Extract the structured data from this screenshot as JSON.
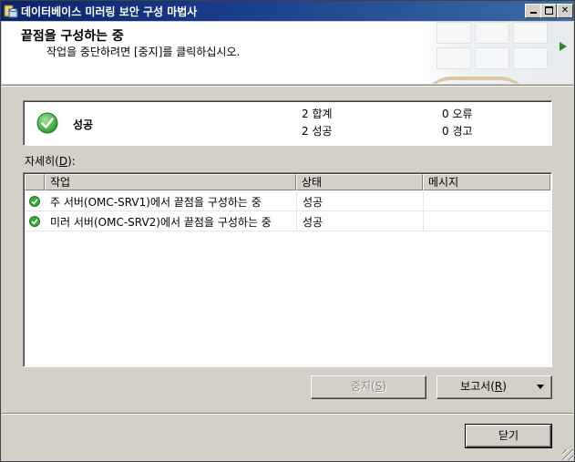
{
  "window": {
    "title": "데이터베이스 미러링 보안 구성 마법사"
  },
  "banner": {
    "heading": "끝점을 구성하는 중",
    "subtitle": "작업을 중단하려면 [중지]를 클릭하십시오."
  },
  "summary": {
    "status": "성공",
    "total_label": "2 합계",
    "success_label": "2 성공",
    "error_label": "0 오류",
    "warning_label": "0 경고"
  },
  "details": {
    "label_prefix": "자세히(",
    "label_key": "D",
    "label_suffix": "):",
    "columns": [
      "작업",
      "상태",
      "메시지"
    ],
    "rows": [
      {
        "task": "주 서버(OMC-SRV1)에서 끝점을 구성하는 중",
        "status": "성공",
        "message": ""
      },
      {
        "task": "미러 서버(OMC-SRV2)에서 끝점을 구성하는 중",
        "status": "성공",
        "message": ""
      }
    ]
  },
  "buttons": {
    "stop_prefix": "중지(",
    "stop_key": "S",
    "stop_suffix": ")",
    "report_prefix": "보고서(",
    "report_key": "R",
    "report_suffix": ")",
    "close": "닫기"
  },
  "colors": {
    "titlebar": "#0a246a",
    "success_green": "#2e9b2e",
    "banner_arrow": "#2a8a2a"
  }
}
